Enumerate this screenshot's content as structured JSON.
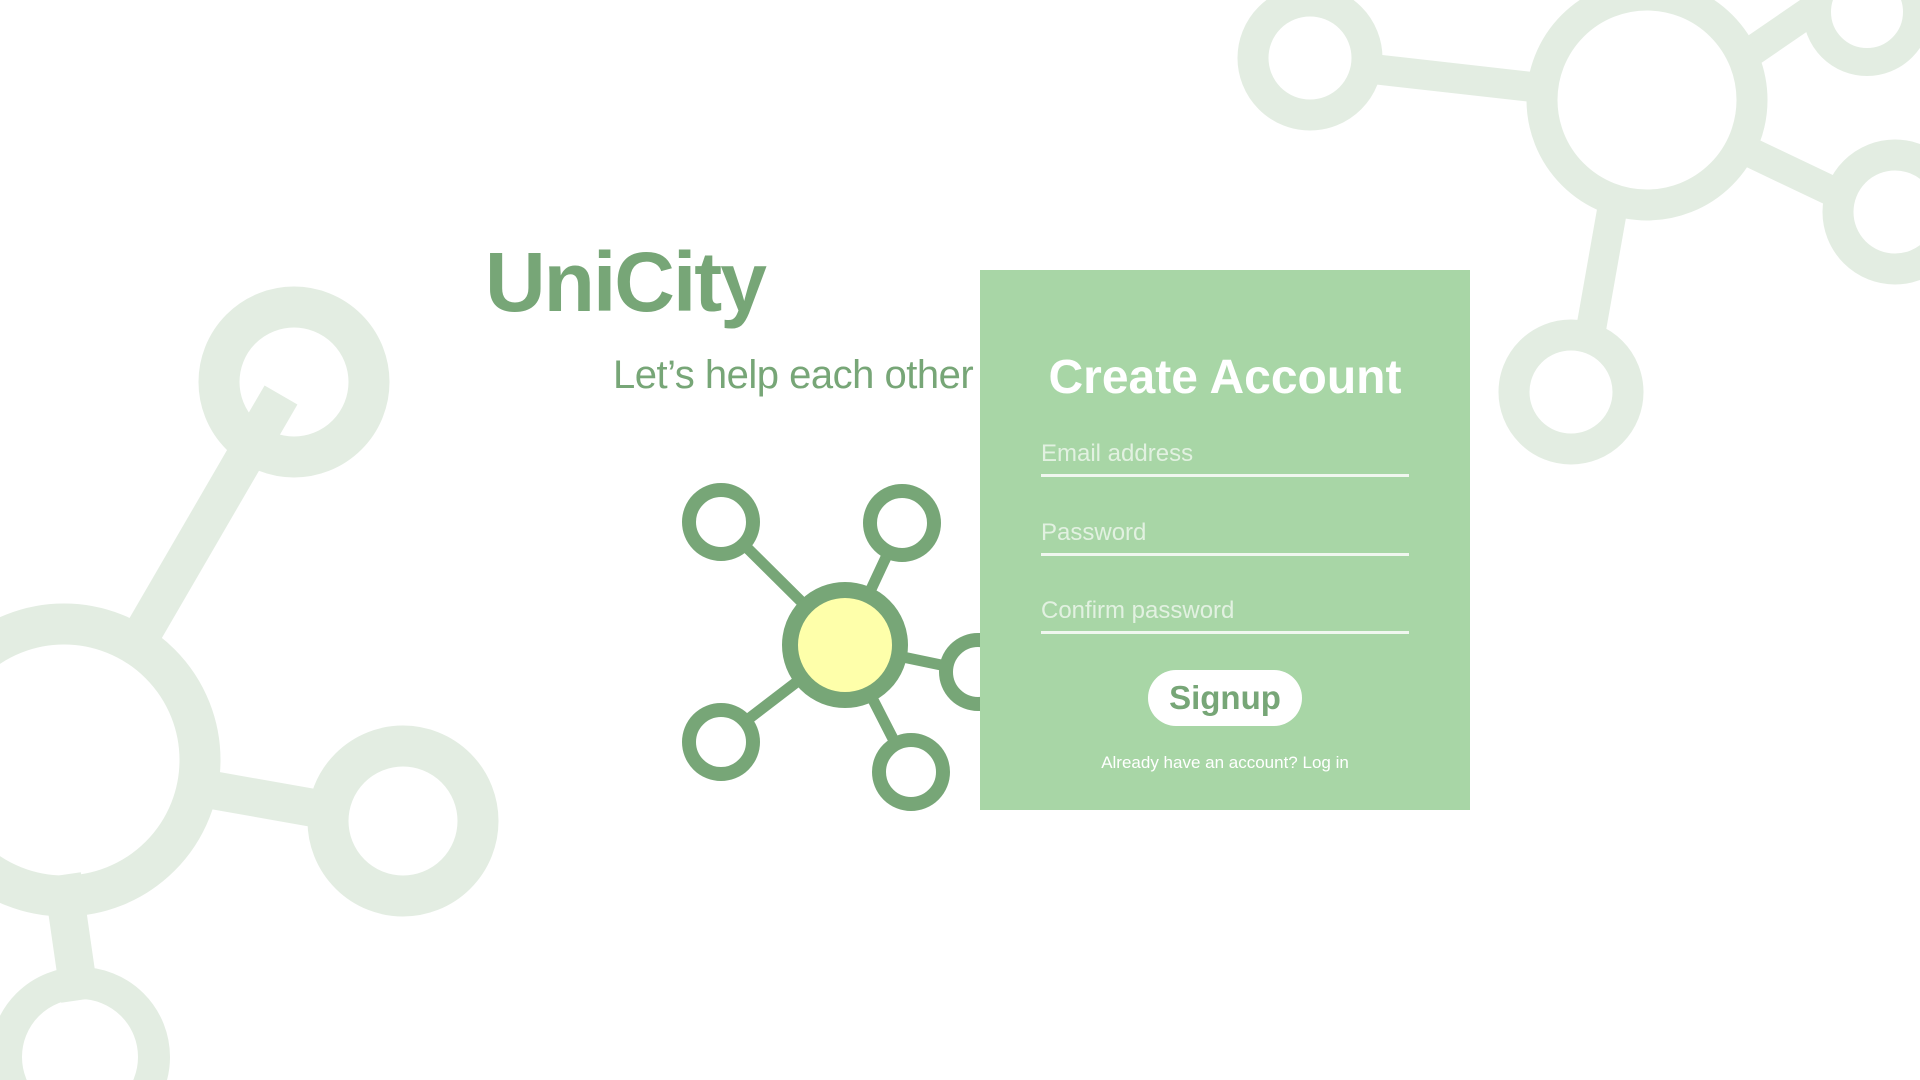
{
  "brand": {
    "title": "UniCity",
    "tagline": "Let’s help each other"
  },
  "signup_form": {
    "heading": "Create Account",
    "email_placeholder": "Email address",
    "password_placeholder": "Password",
    "confirm_placeholder": "Confirm password",
    "submit_label": "Signup",
    "login_prompt": "Already have an account? Log in"
  },
  "icons": {
    "logo": "network-nodes-icon",
    "background": "molecule-decoration"
  },
  "colors": {
    "brand_green": "#77a677",
    "card_green": "#a8d6a6",
    "decor_green": "#e3ede2",
    "logo_center": "#feffaa",
    "white": "#ffffff"
  }
}
